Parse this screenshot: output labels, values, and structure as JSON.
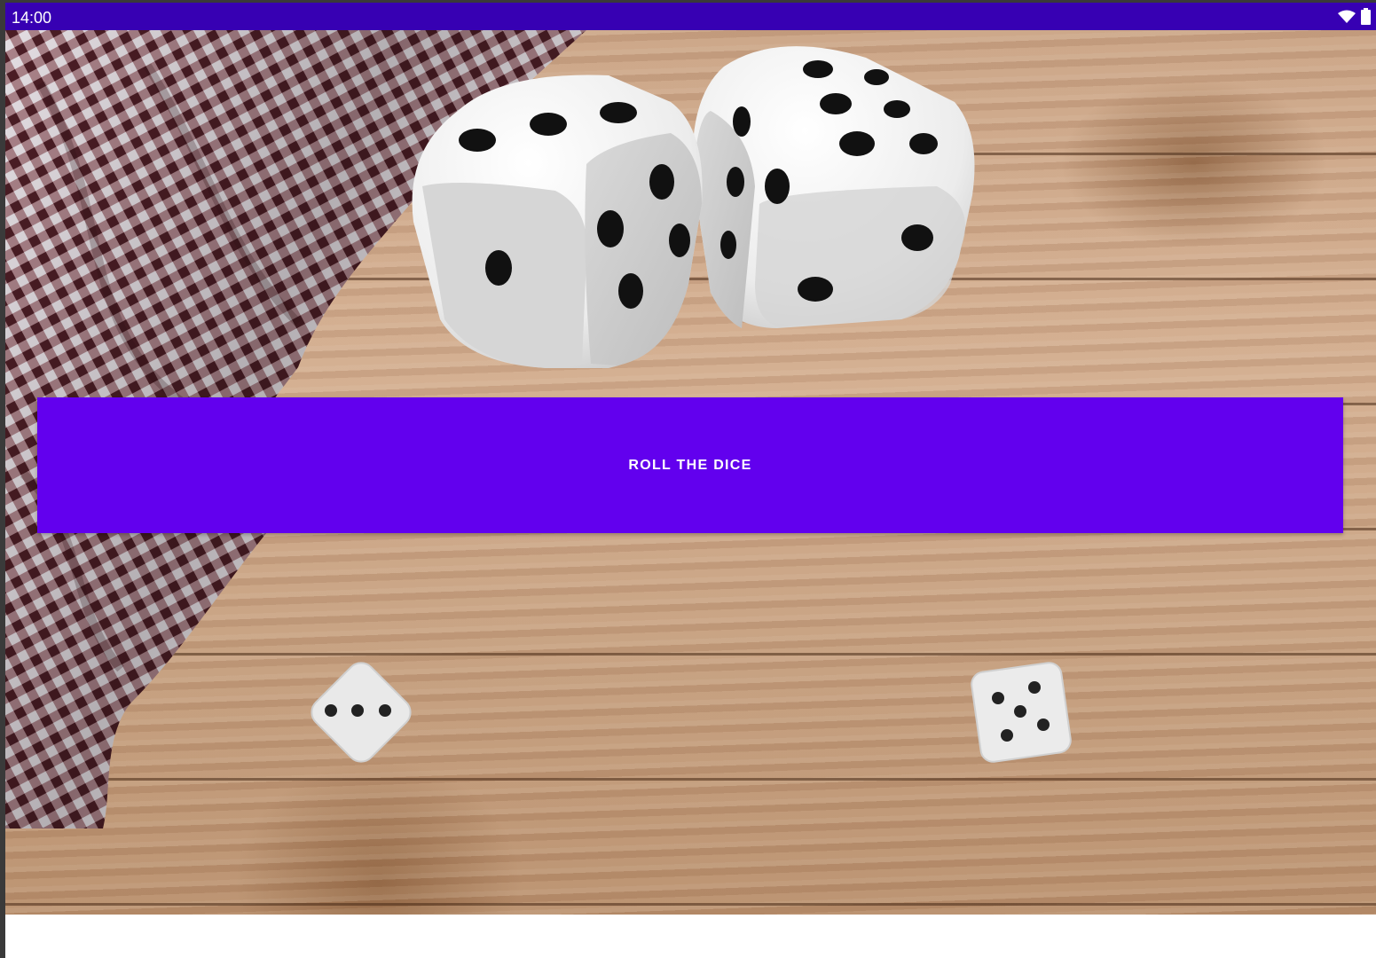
{
  "status_bar": {
    "time": "14:00",
    "icons": [
      "wifi-icon",
      "battery-icon"
    ],
    "color": "#3700b3"
  },
  "app": {
    "background_image": "wooden-table-with-checkered-tablecloth",
    "header_image": "two-large-dice-illustration",
    "roll_button": {
      "label": "ROLL THE DICE",
      "color": "#6200ee"
    },
    "dice": [
      {
        "name": "left-die",
        "value": 3
      },
      {
        "name": "right-die",
        "value": 5
      }
    ]
  }
}
